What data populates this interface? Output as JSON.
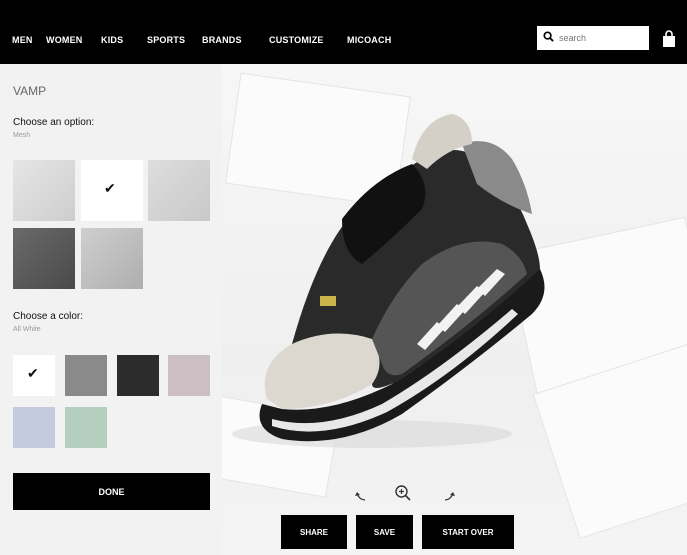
{
  "nav": {
    "items": [
      "MEN",
      "WOMEN",
      "KIDS",
      "SPORTS",
      "BRANDS",
      "CUSTOMIZE",
      "MICOACH"
    ],
    "search_placeholder": "search"
  },
  "panel": {
    "title": "VAMP",
    "option_label": "Choose an option:",
    "option_selected": "Mesh",
    "color_label": "Choose a color:",
    "color_selected": "All White",
    "done_label": "DONE"
  },
  "colors": {
    "option_swatches": [
      "#d9d9d9",
      "#ffffff",
      "#cfcfcf",
      "#595959",
      "#bdbdbd"
    ],
    "color_swatches": [
      "#ffffff",
      "#8a8a8a",
      "#2c2c2c",
      "#cbbfc3",
      "#c4cbe0",
      "#b4cfbe"
    ]
  },
  "actions": {
    "share": "SHARE",
    "save": "SAVE",
    "start_over": "START OVER"
  },
  "icons": [
    "search-icon",
    "shopping-bag-icon",
    "checkmark-icon",
    "rotate-left-icon",
    "zoom-icon",
    "rotate-right-icon"
  ]
}
